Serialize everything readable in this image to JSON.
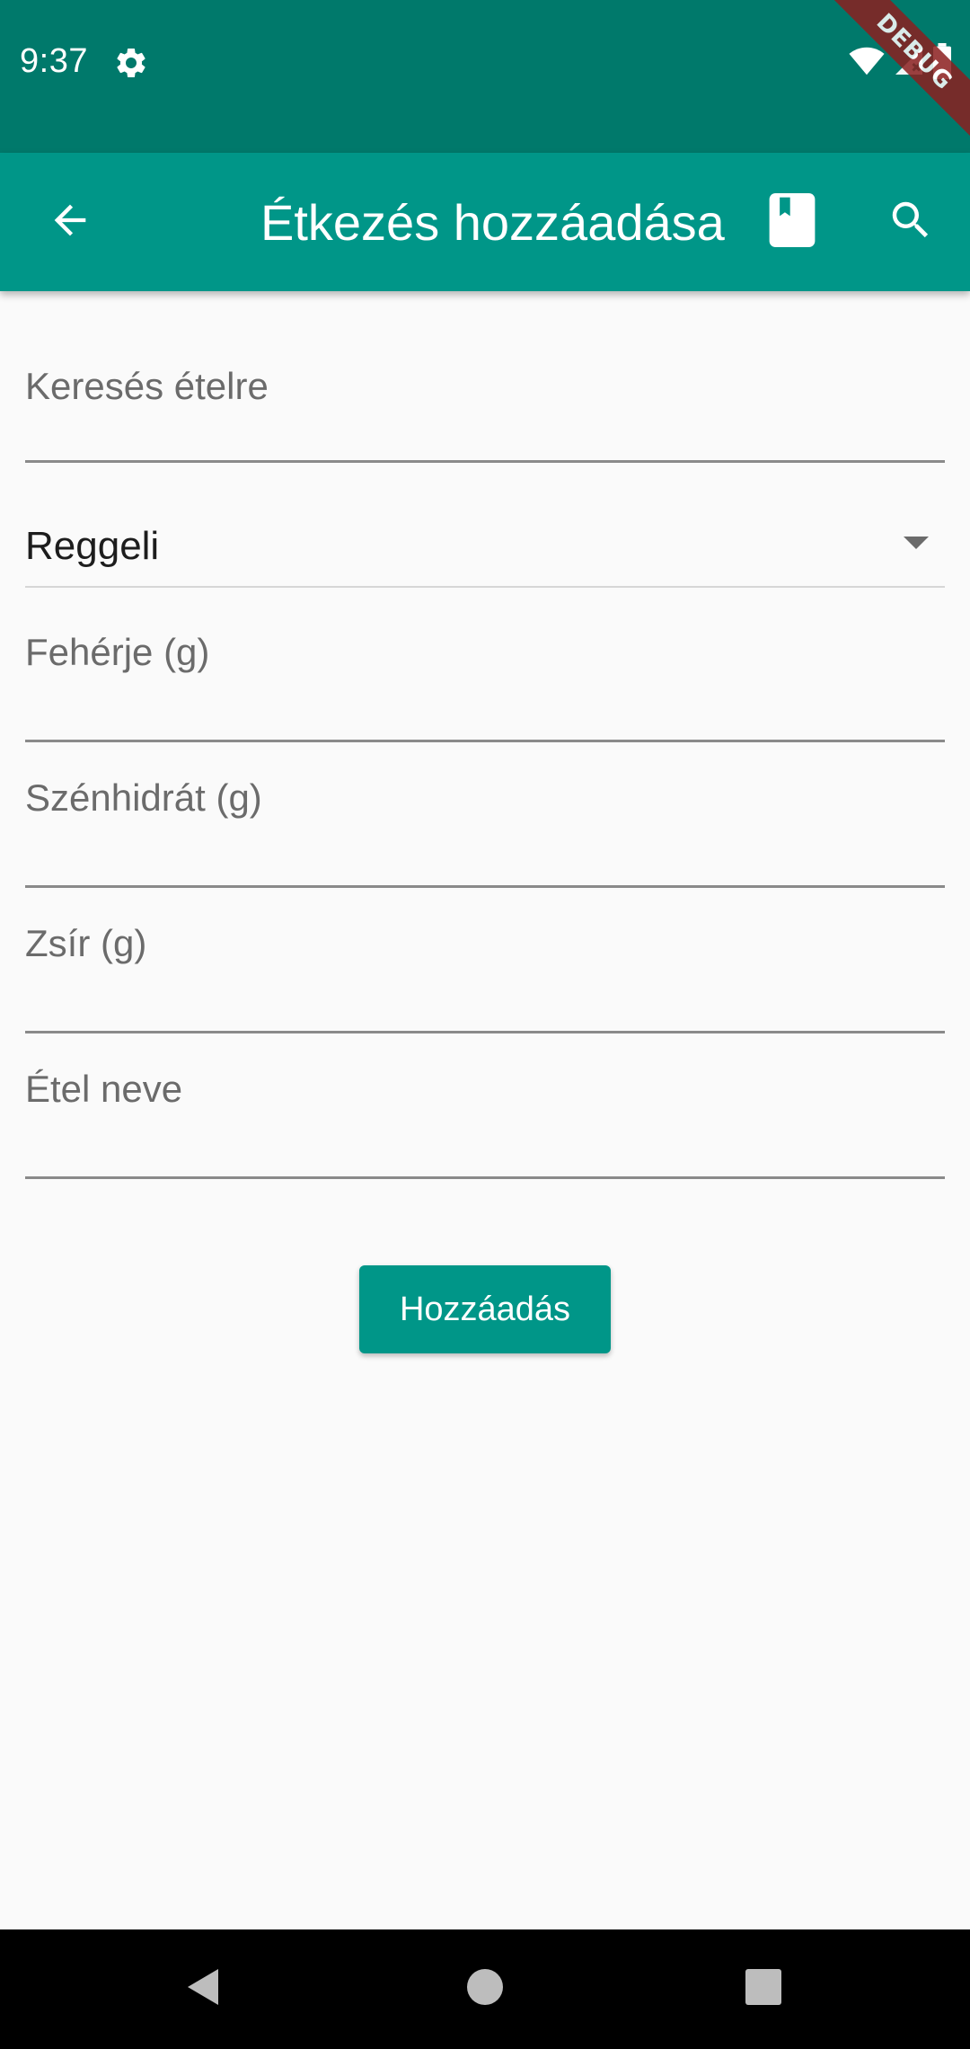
{
  "status_bar": {
    "time": "9:37",
    "debug_label": "DEBUG",
    "colors": {
      "background": "#00796b",
      "ribbon": "#8b1f1f"
    }
  },
  "app_bar": {
    "title": "Étkezés hozzáadása",
    "icons": [
      "arrow-back-icon",
      "book-icon",
      "search-icon"
    ],
    "colors": {
      "background": "#009688",
      "foreground": "#ffffff"
    }
  },
  "form": {
    "search_label": "Keresés ételre",
    "meal_type": {
      "selected": "Reggeli"
    },
    "protein_label": "Fehérje (g)",
    "carbs_label": "Szénhidrát (g)",
    "fat_label": "Zsír (g)",
    "food_name_label": "Étel neve",
    "submit_label": "Hozzáadás",
    "colors": {
      "accent": "#009688",
      "label": "#6b6b6b"
    }
  },
  "nav_bar": {
    "icons": [
      "back-triangle-icon",
      "home-circle-icon",
      "recents-square-icon"
    ]
  }
}
